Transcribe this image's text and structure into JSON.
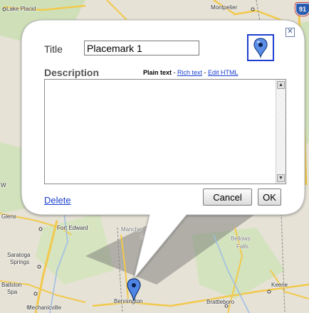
{
  "map": {
    "labels": {
      "lake_placid": "Lake Placid",
      "montpelier": "Montpelier",
      "interstate": "91",
      "glens_falls": "Glens",
      "fort_edward": "Fort Edward",
      "manchester": "Manche",
      "manchester_center": "Cen",
      "bellows": "Bellows",
      "bellows_falls": "Falls",
      "saratoga": "Saratoga",
      "springs": "Springs",
      "ballston": "Ballston",
      "spa": "Spa",
      "mechanicville": "Mechanicville",
      "bennington": "Bennington",
      "brattleboro": "Brattleboro",
      "keene": "Keene",
      "w_edge": "W"
    },
    "colors": {
      "land": "#e8e4d8",
      "forest": "#c8dcb0",
      "road": "#f2c94c",
      "water": "#a9c4e8"
    }
  },
  "balloon": {
    "close_icon": "close-icon",
    "title_label": "Title",
    "title_value": "Placemark 1",
    "icon_picker": "placemark-icon",
    "description_label": "Description",
    "format": {
      "plain_text": "Plain text",
      "sep1": " - ",
      "rich_text": "Rich text",
      "sep2": " - ",
      "edit_html": "Edit HTML"
    },
    "description_value": "",
    "delete_label": "Delete",
    "cancel_label": "Cancel",
    "ok_label": "OK"
  }
}
